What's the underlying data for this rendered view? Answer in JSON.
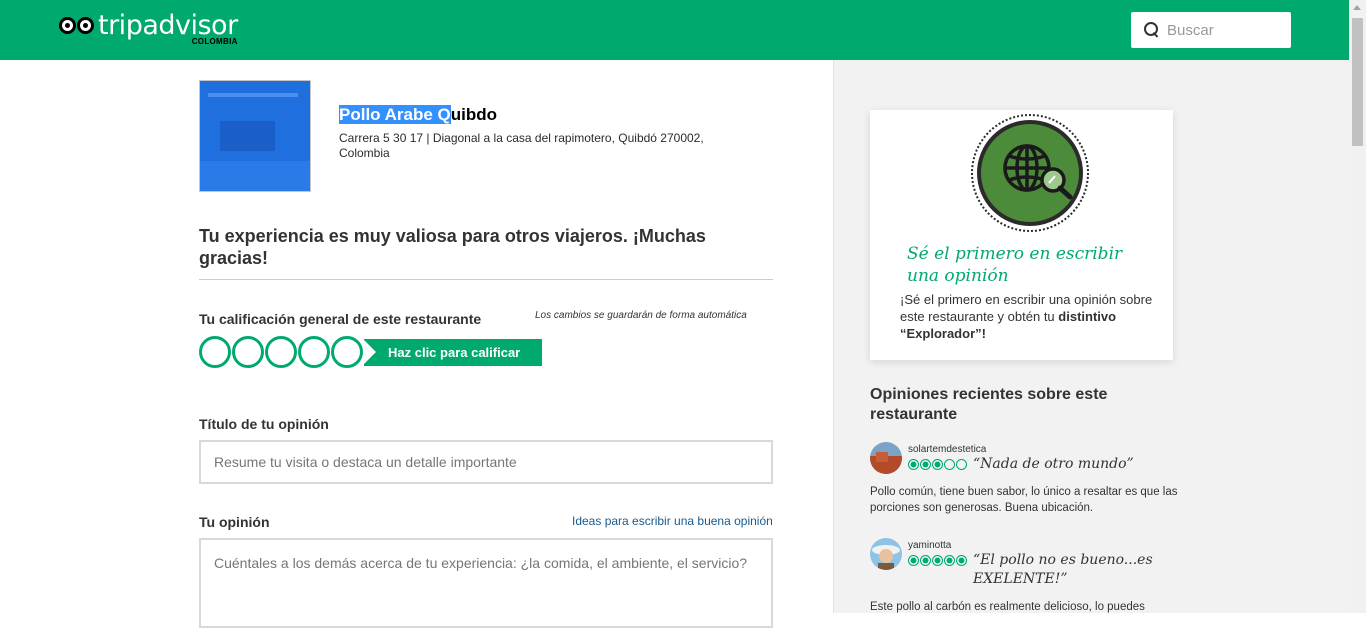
{
  "header": {
    "logo_word": "tripadvisor",
    "logo_country": "COLOMBIA",
    "search_placeholder": "Buscar",
    "brand_color": "#00aa6c"
  },
  "restaurant": {
    "name_selected": "Pollo Arabe Q",
    "name_rest": "uibdo",
    "address": "Carrera 5 30 17 | Diagonal a la casa del rapimotero, Quibdó 270002, Colombia"
  },
  "form": {
    "thanks_heading": "Tu experiencia es muy valiosa para otros viajeros. ¡Muchas gracias!",
    "rating_label": "Tu calificación general de este restaurante",
    "autosave_note": "Los cambios se guardarán de forma automática",
    "rating_cta": "Haz clic para calificar",
    "title_label": "Título de tu opinión",
    "title_placeholder": "Resume tu visita o destaca un detalle importante",
    "review_label": "Tu opinión",
    "tips_link": "Ideas para escribir una buena opinión",
    "review_placeholder": "Cuéntales a los demás acerca de tu experiencia: ¿la comida, el ambiente, el servicio?"
  },
  "sidebar": {
    "badge_icon": "globe-magnifier-icon",
    "badge_title": "Sé el primero en escribir una opinión",
    "badge_text_plain": "¡Sé el primero en escribir una opinión sobre este restaurante y obtén tu ",
    "badge_text_bold": "distintivo “Explorador”!",
    "recent_title": "Opiniones recientes sobre este restaurante",
    "reviews": [
      {
        "user": "solartemdestetica",
        "rating": 3,
        "quote": "“Nada de otro mundo”",
        "text": "Pollo común, tiene buen sabor, lo único a resaltar es que las porciones son generosas. Buena ubicación."
      },
      {
        "user": "yaminotta",
        "rating": 5,
        "quote": "“El pollo no es bueno...es EXELENTE!”",
        "text": "Este pollo al carbón es realmente delicioso, lo puedes"
      }
    ]
  }
}
